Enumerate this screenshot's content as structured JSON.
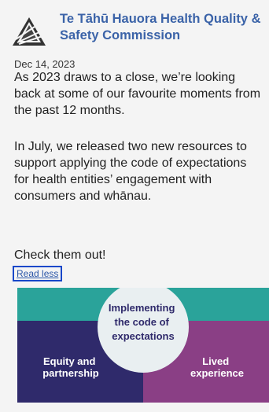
{
  "post": {
    "org_name": "Te Tāhū Hauora Health Quality & Safety Commission",
    "date": "Dec 14, 2023",
    "paragraphs": [
      "As 2023 draws to a close, we’re looking back at some of our favourite moments from the past 12 months.",
      "In July, we released two new resources to support applying the code of expectations for health entities’ engagement with consumers and whānau.",
      "Check them out!"
    ],
    "read_less_label": "Read less",
    "logo_icon": "mountain-logo-icon"
  },
  "image": {
    "center_text": [
      "Implementing",
      "the code of",
      "expectations"
    ],
    "left_text": [
      "Equity and",
      "partnership"
    ],
    "right_text": [
      "Lived",
      "experience"
    ],
    "colors": {
      "top": "#2aa39a",
      "left": "#2f2a6b",
      "right": "#8a3f85",
      "circle": "#e9eff1",
      "circle_text": "#2f2a6b",
      "accent": "#3b63a8",
      "focus": "#1747c9"
    }
  }
}
